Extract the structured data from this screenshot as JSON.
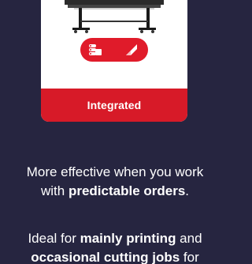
{
  "card": {
    "label": "Integrated",
    "image": "large-format-printer",
    "feature_icons": [
      "print-roll-icon",
      "cut-blade-icon"
    ],
    "colors": {
      "accent": "#e01b2a",
      "footer": "#d71a28",
      "card_bg": "#ffffff"
    }
  },
  "description_1": {
    "line1": "More effective when you work",
    "line2_prefix": "with ",
    "line2_bold": "predictable orders",
    "line2_suffix": "."
  },
  "description_2": {
    "line1_prefix": "Ideal for ",
    "line1_bold": "mainly printing",
    "line1_suffix": " and",
    "line2_bold": "occasional cutting jobs",
    "line2_suffix": " for"
  },
  "colors": {
    "background": "#262540",
    "text": "#ffffff"
  }
}
